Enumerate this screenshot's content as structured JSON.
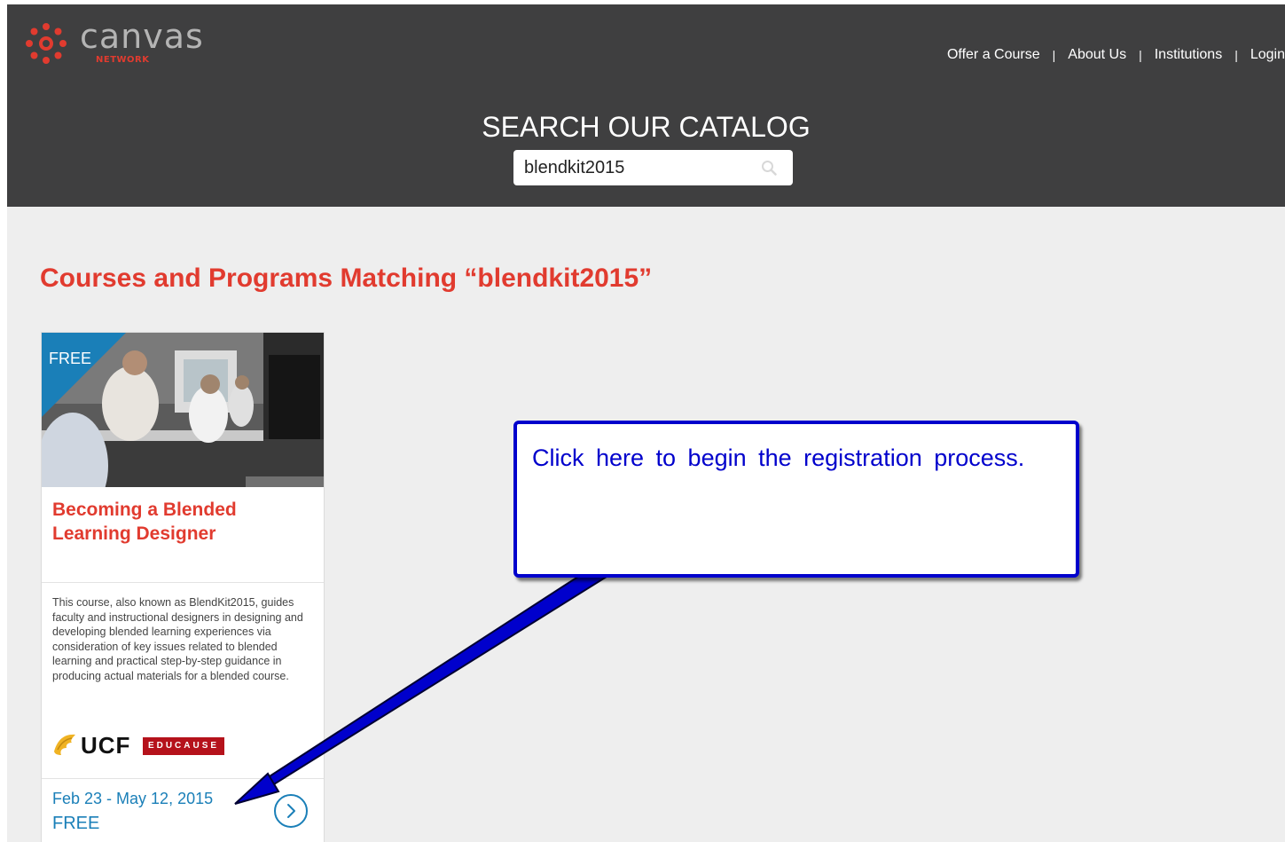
{
  "brand": {
    "name": "canvas",
    "sub": "NETWORK",
    "accent_color": "#e13b2f",
    "header_color": "#3f3f40"
  },
  "nav": {
    "items": [
      "Offer a Course",
      "About Us",
      "Institutions",
      "Login"
    ],
    "separator": "|"
  },
  "search": {
    "title": "SEARCH OUR CATALOG",
    "value": "blendkit2015",
    "icon": "search-icon"
  },
  "results": {
    "heading": "Courses and Programs Matching “blendkit2015”"
  },
  "course": {
    "badge": "FREE",
    "title": "Becoming a Blended Learning Designer",
    "description": "This course, also known as BlendKit2015, guides faculty and instructional designers in designing and developing blended learning experiences via consideration of key issues related to blended learning and practical step-by-step guidance in producing actual materials for a blended course.",
    "partners": [
      "UCF",
      "EDUCAUSE"
    ],
    "dates": "Feb 23 - May 12, 2015",
    "price": "FREE",
    "link_color": "#1a7fb8"
  },
  "callout": {
    "text": "Click here to begin the registration process.",
    "color": "#0000cc"
  }
}
